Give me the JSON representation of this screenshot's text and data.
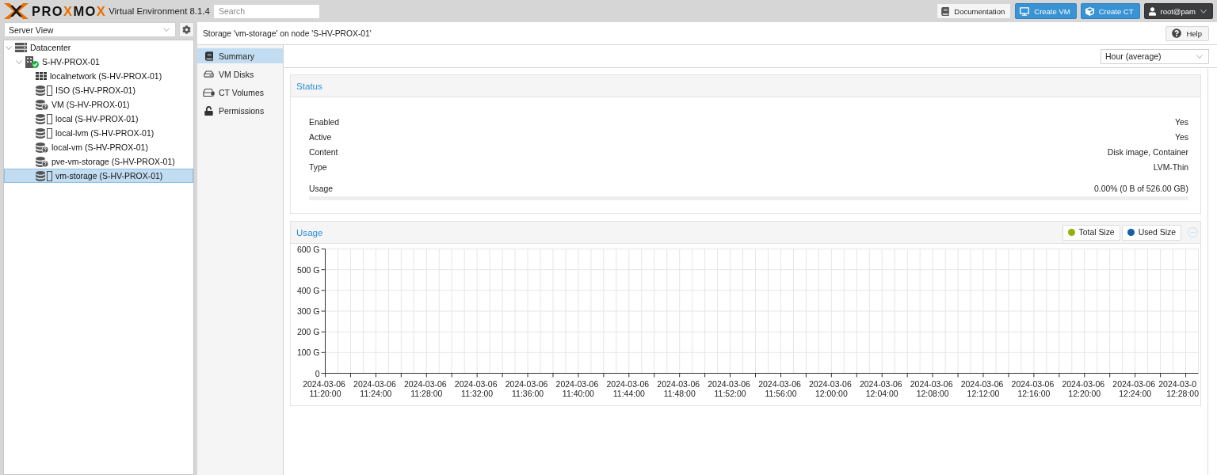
{
  "header": {
    "logo": [
      {
        "text": "PRO",
        "accent": false
      },
      {
        "text": "X",
        "accent": true
      },
      {
        "text": "MO",
        "accent": false
      },
      {
        "text": "X",
        "accent": true
      }
    ],
    "product": "Virtual Environment 8.1.4",
    "search": {
      "placeholder": "Search"
    },
    "documentation_button": "Documentation",
    "create_vm_button": "Create VM",
    "create_ct_button": "Create CT",
    "user_menu": "root@pam"
  },
  "sidebar": {
    "view_selector": {
      "value": "Server View"
    },
    "tree": [
      {
        "label": "Datacenter",
        "kind": "datacenter",
        "expanded": true,
        "selected": false,
        "children": [
          {
            "label": "S-HV-PROX-01",
            "kind": "node",
            "online": true,
            "expanded": true,
            "selected": false,
            "children": [
              {
                "label": "localnetwork (S-HV-PROX-01)",
                "kind": "network",
                "selected": false
              },
              {
                "label": "ISO (S-HV-PROX-01)",
                "kind": "storage",
                "unknown": false,
                "selected": false
              },
              {
                "label": "VM (S-HV-PROX-01)",
                "kind": "storage",
                "unknown": true,
                "selected": false
              },
              {
                "label": "local (S-HV-PROX-01)",
                "kind": "storage",
                "unknown": false,
                "selected": false
              },
              {
                "label": "local-lvm (S-HV-PROX-01)",
                "kind": "storage",
                "unknown": false,
                "selected": false
              },
              {
                "label": "local-vm (S-HV-PROX-01)",
                "kind": "storage",
                "unknown": true,
                "selected": false
              },
              {
                "label": "pve-vm-storage (S-HV-PROX-01)",
                "kind": "storage",
                "unknown": true,
                "selected": false
              },
              {
                "label": "vm-storage (S-HV-PROX-01)",
                "kind": "storage",
                "unknown": false,
                "selected": true
              }
            ]
          }
        ]
      }
    ]
  },
  "content": {
    "title": "Storage 'vm-storage' on node 'S-HV-PROX-01'",
    "help_button": "Help",
    "nav": [
      {
        "label": "Summary",
        "selected": true
      },
      {
        "label": "VM Disks",
        "selected": false
      },
      {
        "label": "CT Volumes",
        "selected": false
      },
      {
        "label": "Permissions",
        "selected": false
      }
    ],
    "timeframe": {
      "value": "Hour (average)"
    },
    "status_panel": {
      "title": "Status",
      "rows": [
        {
          "label": "Enabled",
          "value": "Yes"
        },
        {
          "label": "Active",
          "value": "Yes"
        },
        {
          "label": "Content",
          "value": "Disk image, Container"
        },
        {
          "label": "Type",
          "value": "LVM-Thin"
        }
      ],
      "usage": {
        "label": "Usage",
        "value": "0.00% (0 B of 526.00 GB)"
      }
    },
    "usage_panel": {
      "title": "Usage",
      "chart_data": {
        "type": "line",
        "grid": true,
        "categories": [
          "2024-03-06 11:20:00",
          "2024-03-06 11:24:00",
          "2024-03-06 11:28:00",
          "2024-03-06 11:32:00",
          "2024-03-06 11:36:00",
          "2024-03-06 11:40:00",
          "2024-03-06 11:44:00",
          "2024-03-06 11:48:00",
          "2024-03-06 11:52:00",
          "2024-03-06 11:56:00",
          "2024-03-06 12:00:00",
          "2024-03-06 12:04:00",
          "2024-03-06 12:08:00",
          "2024-03-06 12:12:00",
          "2024-03-06 12:16:00",
          "2024-03-06 12:20:00",
          "2024-03-06 12:24:00",
          "2024-03-0 12:28:00"
        ],
        "series": [
          {
            "name": "Total Size",
            "color": "#94ae0a",
            "values": [
              null,
              null,
              null,
              null,
              null,
              null,
              null,
              null,
              null,
              null,
              null,
              null,
              null,
              null,
              null,
              null,
              null,
              null
            ]
          },
          {
            "name": "Used Size",
            "color": "#115fa6",
            "values": [
              null,
              null,
              null,
              null,
              null,
              null,
              null,
              null,
              null,
              null,
              null,
              null,
              null,
              null,
              null,
              null,
              null,
              null
            ]
          }
        ],
        "ylim": [
          0,
          600
        ],
        "yticks": [
          {
            "value": 0,
            "label": "0"
          },
          {
            "value": 100,
            "label": "100 G"
          },
          {
            "value": 200,
            "label": "200 G"
          },
          {
            "value": 300,
            "label": "300 G"
          },
          {
            "value": 400,
            "label": "400 G"
          },
          {
            "value": 500,
            "label": "500 G"
          },
          {
            "value": 600,
            "label": "600 G"
          }
        ]
      }
    }
  }
}
